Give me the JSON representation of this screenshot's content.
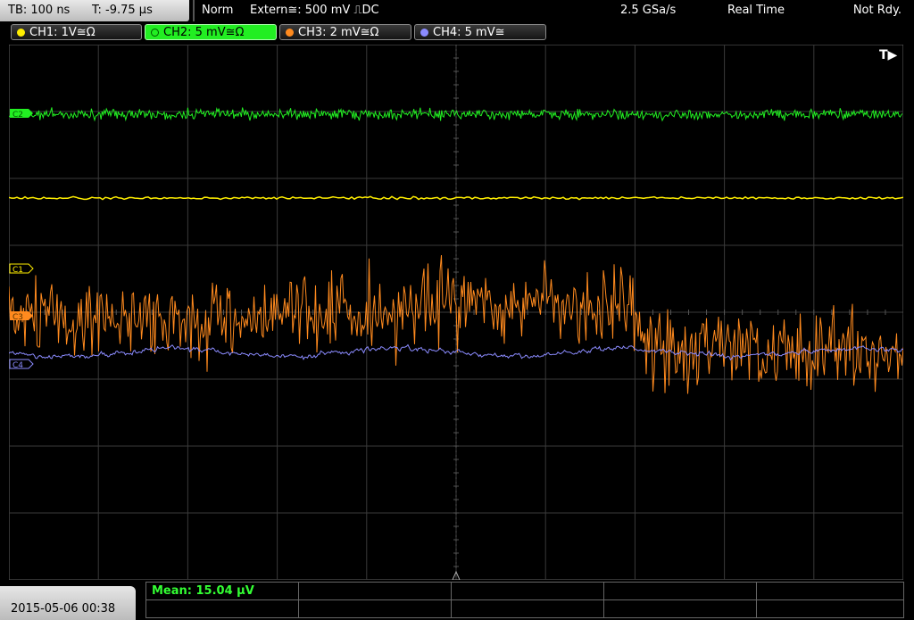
{
  "topbar": {
    "timebase": "TB: 100 ns",
    "trigger_time": "T: -9.75 µs",
    "trigger_mode": "Norm",
    "trigger_source": "Extern≅: 500 mV ⎍DC",
    "sample_rate": "2.5 GSa/s",
    "acquisition_mode": "Real Time",
    "run_state": "Not Rdy."
  },
  "channels": [
    {
      "label": "CH1: 1V≅Ω",
      "color": "#ffee00",
      "marker": "C1"
    },
    {
      "label": "CH2: 5 mV≅Ω",
      "color": "#22ee22",
      "marker": "C2",
      "active": true
    },
    {
      "label": "CH3: 2 mV≅Ω",
      "color": "#ff8a1e",
      "marker": "C3"
    },
    {
      "label": "CH4: 5 mV≅",
      "color": "#8b8bff",
      "marker": "C4"
    }
  ],
  "trigger_indicator": "T▶",
  "measurement": {
    "mean_label": "Mean: 15.04 µV"
  },
  "footer": {
    "datetime": "2015-05-06 00:38"
  }
}
